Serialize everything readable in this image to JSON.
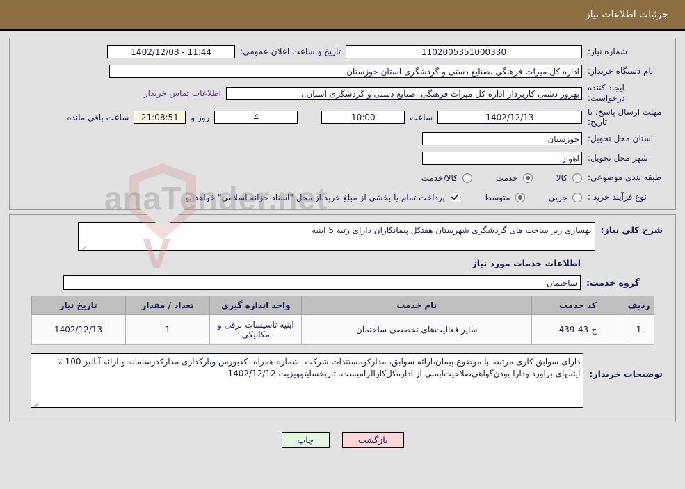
{
  "header": {
    "title": "جزئیات اطلاعات نیاز",
    "bg_color": "#8d6d42",
    "text_color": "#ffffff"
  },
  "watermark": {
    "text": "anaTender.net",
    "v_letter": "V"
  },
  "form": {
    "need_number": {
      "label": "شماره نیاز:",
      "value": "1102005351000330"
    },
    "public_announce": {
      "label": "تاریخ و ساعت اعلان عمومي:",
      "value": "11:44 - 1402/12/08"
    },
    "buyer_org": {
      "label": "نام دستگاه خریدار:",
      "value": "اداره کل میراث فرهنگی ،صنایع دستی و گردشگری استان خوزستان"
    },
    "creator": {
      "label": "ایجاد کننده درخواست:",
      "value": "بهروز دشتی کاربرداز اداره کل میراث فرهنگی ،صنایع دستی و گردشگری استان ،",
      "contact_link": "اطلاعات تماس خریدار"
    },
    "deadline": {
      "label": "مهلت ارسال پاسخ: تا تاریخ:",
      "date": "1402/12/13",
      "hour_label": "ساعت",
      "hour": "10:00",
      "days": "4",
      "days_label": "روز و",
      "timer": "21:08:51",
      "timer_label": "ساعت باقي مانده"
    },
    "delivery_province": {
      "label": "استان محل تحویل:",
      "value": "خوزستان"
    },
    "delivery_city": {
      "label": "شهر محل تحویل:",
      "value": "اهواز"
    },
    "category": {
      "label": "طبقه بندی موضوعی:",
      "options": [
        "کالا",
        "خدمت",
        "کالا/خدمت"
      ],
      "selected": "خدمت"
    },
    "purchase_type": {
      "label": "نوع فرآیند خرید :",
      "options": [
        "جزیي",
        "متوسط"
      ],
      "selected": "متوسط",
      "payment_checked": true,
      "payment_note": "پرداخت تمام یا بخشی از مبلغ خرید،از محل \"اسناد خزانه اسلامی\" خواهد بود."
    }
  },
  "description": {
    "label": "شرح کلي نیاز:",
    "value": "بهسازی زیر ساخت های گردشگری شهرستان هفتکل پیمانکاران دارای رتبه 5 ابنیه"
  },
  "services_section": {
    "heading": "اطلاعات خدمات مورد نیاز",
    "group_label": "گروه خدمت:",
    "group_value": "ساختمان"
  },
  "table": {
    "columns": [
      "ردیف",
      "کد خدمت",
      "نام خدمت",
      "واحد اندازه گیری",
      "تعداد / مقدار",
      "تاریخ نیاز"
    ],
    "rows": [
      {
        "row_no": "1",
        "service_code": "ج-43-439",
        "service_name": "سایر فعالیت‌های تخصصی ساختمان",
        "unit": "ابنیه تاسیسات برقی و مکانیکی",
        "quantity": "1",
        "need_date": "1402/12/13"
      }
    ]
  },
  "buyer_notes": {
    "label": "توضیحات خریدار:",
    "value": "دارای سوابق کاری مرتبط با موضوع پیمان،ارائه سوابق، مدارکومستندات شرکت -شماره همراه -کدبورس وبارگذاری مدارکدرسامانه و ارائه آنالیز 100 ٪ آیتمهای برآورد ودارا بودن‌گواهی‌صلاحیت‌ایمنی از اداره‌کل‌کارالزامیست. تاریخسایتوویزیت 1402/12/12"
  },
  "footer": {
    "print_button": "چاپ",
    "return_button": "بازگشت"
  }
}
